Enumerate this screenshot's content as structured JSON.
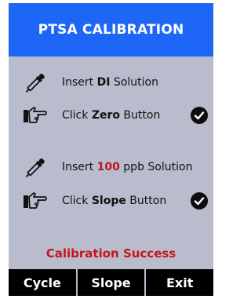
{
  "header": {
    "title": "PTSA CALIBRATION"
  },
  "steps": [
    {
      "icon": "pipette-icon",
      "prefix": "Insert ",
      "emphasis": "DI",
      "suffix": " Solution",
      "done": false
    },
    {
      "icon": "pointing-hand-icon",
      "prefix": "Click ",
      "emphasis": "Zero",
      "suffix": " Button",
      "done": true
    },
    {
      "icon": "pipette-icon",
      "prefix": "Insert ",
      "emphasis": "100",
      "suffix": " ppb Solution",
      "done": false
    },
    {
      "icon": "pointing-hand-icon",
      "prefix": "Click ",
      "emphasis": "Slope",
      "suffix": " Button",
      "done": true
    }
  ],
  "status": "Calibration Success",
  "footer": {
    "cycle_label": "Cycle",
    "slope_label": "Slope",
    "exit_label": "Exit"
  },
  "colors": {
    "header": "#1e66f5",
    "screen_bg": "#b8bccc",
    "status_text": "#c8141c",
    "footer_bg": "#000000"
  }
}
